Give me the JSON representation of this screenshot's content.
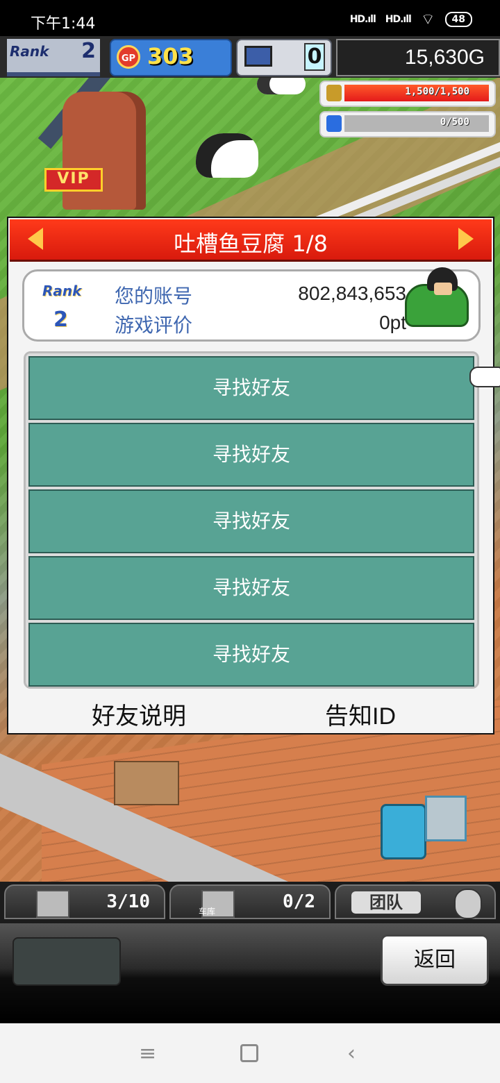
{
  "status_bar": {
    "time": "下午1:44",
    "signal1": "HD.ıll",
    "signal2": "HD.ıll",
    "battery": "48"
  },
  "hud": {
    "rank_word": "Rank",
    "rank": "2",
    "gp_badge": "GP",
    "gp": "303",
    "pc_count": "0",
    "money": "15,630G",
    "fuel": {
      "text": "1,500/1,500",
      "fraction": 1.0
    },
    "water": {
      "text": "0/500",
      "fraction": 0.0
    }
  },
  "scene": {
    "vip": "VIP"
  },
  "dialog": {
    "title": "吐槽鱼豆腐 1/8",
    "rank_word": "Rank",
    "rank": "2",
    "account_label": "您的账号",
    "account_value": "802,843,653",
    "rating_label": "游戏评价",
    "rating_value": "0pt",
    "friend_slots": [
      "寻找好友",
      "寻找好友",
      "寻找好友",
      "寻找好友",
      "寻找好友"
    ],
    "friend_help": "好友说明",
    "notify_id": "告知ID"
  },
  "bottom_tabs": {
    "storage": "3/10",
    "garage_label": "车库",
    "garage": "0/2",
    "team": "团队"
  },
  "actions": {
    "back": "返回"
  },
  "nav": {
    "menu": "≡",
    "back": "‹"
  }
}
